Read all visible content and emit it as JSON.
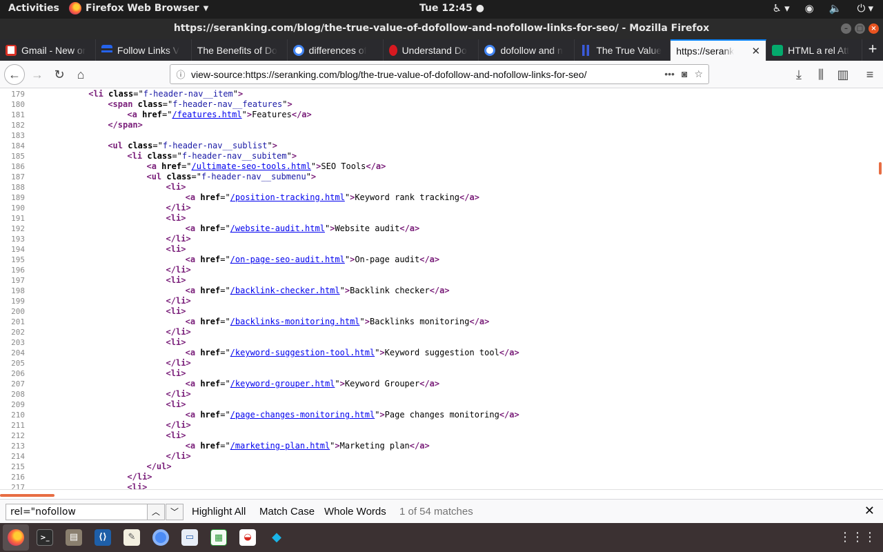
{
  "topbar": {
    "activities": "Activities",
    "app_name": "Firefox Web Browser",
    "clock": "Tue 12:45 ●"
  },
  "window": {
    "title": "https://seranking.com/blog/the-true-value-of-dofollow-and-nofollow-links-for-seo/ - Mozilla Firefox"
  },
  "tabs": [
    {
      "label": "Gmail - New or",
      "favicon_color": "#d93025"
    },
    {
      "label": "Follow Links V",
      "favicon_color": "#2563eb"
    },
    {
      "label": "The Benefits of Do",
      "favicon_color": "#2a2a2e"
    },
    {
      "label": "differences of",
      "favicon_color": "#ffffff"
    },
    {
      "label": "Understand Do",
      "favicon_color": "#d71920"
    },
    {
      "label": "dofollow and n",
      "favicon_color": "#ffffff"
    },
    {
      "label": "The True Value",
      "favicon_color": "#3b5bdb"
    },
    {
      "label": "https://serank",
      "favicon_color": "none",
      "active": true
    },
    {
      "label": "HTML a rel Att",
      "favicon_color": "#04aa6d"
    }
  ],
  "navbar": {
    "url": "view-source:https://seranking.com/blog/the-true-value-of-dofollow-and-nofollow-links-for-seo/"
  },
  "source_lines": [
    {
      "n": "179",
      "indent": 6,
      "html": "<span class=\"tag\">&lt;li</span> <span class=\"attr\">class</span>=\"<span class=\"val\">f-header-nav__item</span>\"<span class=\"tag\">&gt;</span>"
    },
    {
      "n": "180",
      "indent": 8,
      "html": "<span class=\"tag\">&lt;span</span> <span class=\"attr\">class</span>=\"<span class=\"val\">f-header-nav__features</span>\"<span class=\"tag\">&gt;</span>"
    },
    {
      "n": "181",
      "indent": 10,
      "html": "<span class=\"tag\">&lt;a</span> <span class=\"attr\">href</span>=\"<span class=\"lnk\">/features.html</span>\"<span class=\"tag\">&gt;</span>Features<span class=\"tag\">&lt;/a&gt;</span>"
    },
    {
      "n": "182",
      "indent": 8,
      "html": "<span class=\"tag\">&lt;/span&gt;</span>"
    },
    {
      "n": "183",
      "indent": 0,
      "html": ""
    },
    {
      "n": "184",
      "indent": 8,
      "html": "<span class=\"tag\">&lt;ul</span> <span class=\"attr\">class</span>=\"<span class=\"val\">f-header-nav__sublist</span>\"<span class=\"tag\">&gt;</span>"
    },
    {
      "n": "185",
      "indent": 10,
      "html": "<span class=\"tag\">&lt;li</span> <span class=\"attr\">class</span>=\"<span class=\"val\">f-header-nav__subitem</span>\"<span class=\"tag\">&gt;</span>"
    },
    {
      "n": "186",
      "indent": 12,
      "html": "<span class=\"tag\">&lt;a</span> <span class=\"attr\">href</span>=\"<span class=\"lnk\">/ultimate-seo-tools.html</span>\"<span class=\"tag\">&gt;</span>SEO Tools<span class=\"tag\">&lt;/a&gt;</span>"
    },
    {
      "n": "187",
      "indent": 12,
      "html": "<span class=\"tag\">&lt;ul</span> <span class=\"attr\">class</span>=\"<span class=\"val\">f-header-nav__submenu</span>\"<span class=\"tag\">&gt;</span>"
    },
    {
      "n": "188",
      "indent": 14,
      "html": "<span class=\"tag\">&lt;li&gt;</span>"
    },
    {
      "n": "189",
      "indent": 16,
      "html": "<span class=\"tag\">&lt;a</span> <span class=\"attr\">href</span>=\"<span class=\"lnk\">/position-tracking.html</span>\"<span class=\"tag\">&gt;</span>Keyword rank tracking<span class=\"tag\">&lt;/a&gt;</span>"
    },
    {
      "n": "190",
      "indent": 14,
      "html": "<span class=\"tag\">&lt;/li&gt;</span>"
    },
    {
      "n": "191",
      "indent": 14,
      "html": "<span class=\"tag\">&lt;li&gt;</span>"
    },
    {
      "n": "192",
      "indent": 16,
      "html": "<span class=\"tag\">&lt;a</span> <span class=\"attr\">href</span>=\"<span class=\"lnk\">/website-audit.html</span>\"<span class=\"tag\">&gt;</span>Website audit<span class=\"tag\">&lt;/a&gt;</span>"
    },
    {
      "n": "193",
      "indent": 14,
      "html": "<span class=\"tag\">&lt;/li&gt;</span>"
    },
    {
      "n": "194",
      "indent": 14,
      "html": "<span class=\"tag\">&lt;li&gt;</span>"
    },
    {
      "n": "195",
      "indent": 16,
      "html": "<span class=\"tag\">&lt;a</span> <span class=\"attr\">href</span>=\"<span class=\"lnk\">/on-page-seo-audit.html</span>\"<span class=\"tag\">&gt;</span>On-page audit<span class=\"tag\">&lt;/a&gt;</span>"
    },
    {
      "n": "196",
      "indent": 14,
      "html": "<span class=\"tag\">&lt;/li&gt;</span>"
    },
    {
      "n": "197",
      "indent": 14,
      "html": "<span class=\"tag\">&lt;li&gt;</span>"
    },
    {
      "n": "198",
      "indent": 16,
      "html": "<span class=\"tag\">&lt;a</span> <span class=\"attr\">href</span>=\"<span class=\"lnk\">/backlink-checker.html</span>\"<span class=\"tag\">&gt;</span>Backlink checker<span class=\"tag\">&lt;/a&gt;</span>"
    },
    {
      "n": "199",
      "indent": 14,
      "html": "<span class=\"tag\">&lt;/li&gt;</span>"
    },
    {
      "n": "200",
      "indent": 14,
      "html": "<span class=\"tag\">&lt;li&gt;</span>"
    },
    {
      "n": "201",
      "indent": 16,
      "html": "<span class=\"tag\">&lt;a</span> <span class=\"attr\">href</span>=\"<span class=\"lnk\">/backlinks-monitoring.html</span>\"<span class=\"tag\">&gt;</span>Backlinks monitoring<span class=\"tag\">&lt;/a&gt;</span>"
    },
    {
      "n": "202",
      "indent": 14,
      "html": "<span class=\"tag\">&lt;/li&gt;</span>"
    },
    {
      "n": "203",
      "indent": 14,
      "html": "<span class=\"tag\">&lt;li&gt;</span>"
    },
    {
      "n": "204",
      "indent": 16,
      "html": "<span class=\"tag\">&lt;a</span> <span class=\"attr\">href</span>=\"<span class=\"lnk\">/keyword-suggestion-tool.html</span>\"<span class=\"tag\">&gt;</span>Keyword suggestion tool<span class=\"tag\">&lt;/a&gt;</span>"
    },
    {
      "n": "205",
      "indent": 14,
      "html": "<span class=\"tag\">&lt;/li&gt;</span>"
    },
    {
      "n": "206",
      "indent": 14,
      "html": "<span class=\"tag\">&lt;li&gt;</span>"
    },
    {
      "n": "207",
      "indent": 16,
      "html": "<span class=\"tag\">&lt;a</span> <span class=\"attr\">href</span>=\"<span class=\"lnk\">/keyword-grouper.html</span>\"<span class=\"tag\">&gt;</span>Keyword Grouper<span class=\"tag\">&lt;/a&gt;</span>"
    },
    {
      "n": "208",
      "indent": 14,
      "html": "<span class=\"tag\">&lt;/li&gt;</span>"
    },
    {
      "n": "209",
      "indent": 14,
      "html": "<span class=\"tag\">&lt;li&gt;</span>"
    },
    {
      "n": "210",
      "indent": 16,
      "html": "<span class=\"tag\">&lt;a</span> <span class=\"attr\">href</span>=\"<span class=\"lnk\">/page-changes-monitoring.html</span>\"<span class=\"tag\">&gt;</span>Page changes monitoring<span class=\"tag\">&lt;/a&gt;</span>"
    },
    {
      "n": "211",
      "indent": 14,
      "html": "<span class=\"tag\">&lt;/li&gt;</span>"
    },
    {
      "n": "212",
      "indent": 14,
      "html": "<span class=\"tag\">&lt;li&gt;</span>"
    },
    {
      "n": "213",
      "indent": 16,
      "html": "<span class=\"tag\">&lt;a</span> <span class=\"attr\">href</span>=\"<span class=\"lnk\">/marketing-plan.html</span>\"<span class=\"tag\">&gt;</span>Marketing plan<span class=\"tag\">&lt;/a&gt;</span>"
    },
    {
      "n": "214",
      "indent": 14,
      "html": "<span class=\"tag\">&lt;/li&gt;</span>"
    },
    {
      "n": "215",
      "indent": 12,
      "html": "<span class=\"tag\">&lt;/ul&gt;</span>"
    },
    {
      "n": "216",
      "indent": 10,
      "html": "<span class=\"tag\">&lt;/li&gt;</span>"
    },
    {
      "n": "217",
      "indent": 10,
      "html": "<span class=\"tag\">&lt;li&gt;</span>"
    }
  ],
  "findbar": {
    "query": "rel=\"nofollow",
    "highlight_all": "Highlight All",
    "match_case": "Match Case",
    "whole_words": "Whole Words",
    "status": "1 of 54 matches"
  },
  "dock": [
    {
      "name": "firefox",
      "active": true
    },
    {
      "name": "terminal"
    },
    {
      "name": "files"
    },
    {
      "name": "vscode"
    },
    {
      "name": "text-editor"
    },
    {
      "name": "chromium"
    },
    {
      "name": "document-viewer"
    },
    {
      "name": "spreadsheet"
    },
    {
      "name": "screenshot-tool"
    },
    {
      "name": "kodi"
    }
  ],
  "colors": {
    "accent": "#0a84ff",
    "ubuntu_orange": "#e95420",
    "tag": "#7a1f7a",
    "link": "#0000ee"
  }
}
